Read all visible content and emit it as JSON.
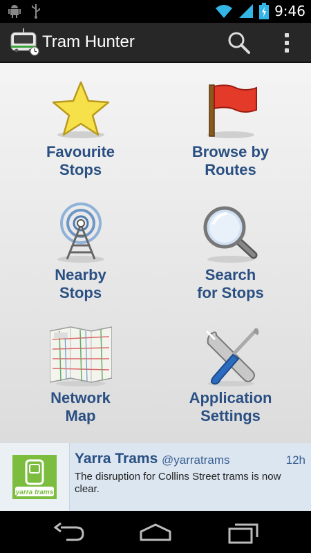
{
  "status_bar": {
    "time": "9:46",
    "icons": [
      "android-debug-icon",
      "usb-icon",
      "wifi-icon",
      "signal-icon",
      "battery-charging-icon"
    ]
  },
  "action_bar": {
    "title": "Tram Hunter",
    "actions": [
      "search-icon",
      "overflow-menu-icon"
    ]
  },
  "menu": {
    "items": [
      {
        "line1": "Favourite",
        "line2": "Stops",
        "icon": "star-icon"
      },
      {
        "line1": "Browse by",
        "line2": "Routes",
        "icon": "flag-icon"
      },
      {
        "line1": "Nearby",
        "line2": "Stops",
        "icon": "radio-tower-icon"
      },
      {
        "line1": "Search",
        "line2": "for Stops",
        "icon": "magnifier-icon"
      },
      {
        "line1": "Network",
        "line2": "Map",
        "icon": "map-icon"
      },
      {
        "line1": "Application",
        "line2": "Settings",
        "icon": "tools-icon"
      }
    ]
  },
  "tweet": {
    "name": "Yarra Trams",
    "handle": "@yarratrams",
    "time": "12h",
    "text": "The disruption for Collins Street trams is now clear.",
    "logo_text": "yarra trams"
  },
  "colors": {
    "label_blue": "#2a4f82",
    "tweet_bg": "#dbe6f1",
    "yarra_green": "#7cbd3f"
  }
}
